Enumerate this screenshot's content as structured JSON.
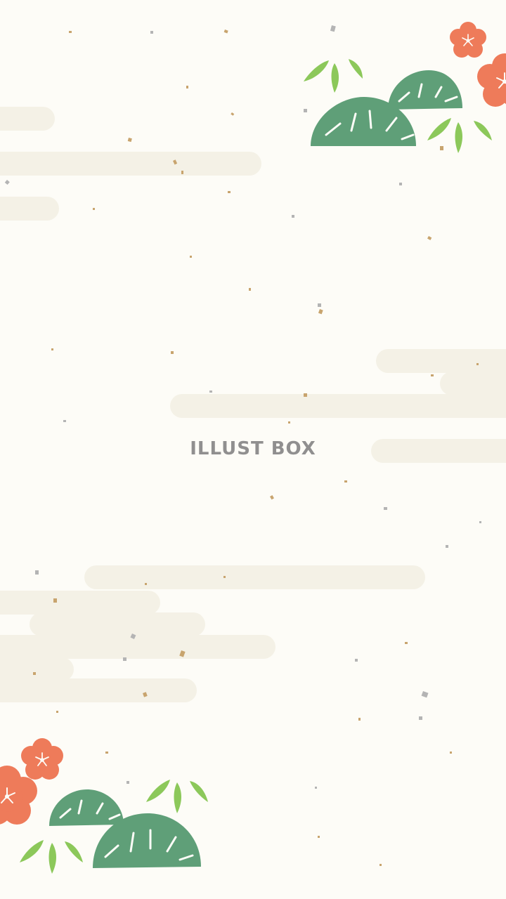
{
  "watermark": {
    "text": "ILLUST BOX"
  },
  "palette": {
    "background": "#fdfcf7",
    "mist": "#f4f1e6",
    "plum_blossom": "#ee7b5a",
    "pine": "#5f9f78",
    "bamboo_leaf": "#8cc85a",
    "gold_fleck": "#c8a46e",
    "silver_fleck": "#b4b4b4"
  },
  "decorations": {
    "top_right": [
      "plum-blossom-icon",
      "pine-icon",
      "bamboo-leaves-icon"
    ],
    "bottom_left": [
      "plum-blossom-icon",
      "pine-icon",
      "bamboo-leaves-icon"
    ]
  }
}
